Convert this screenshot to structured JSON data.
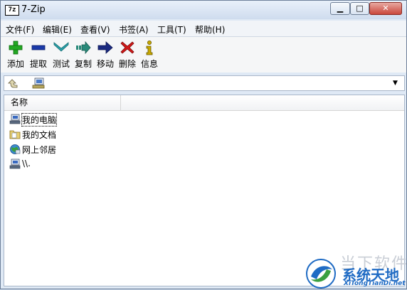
{
  "window": {
    "app_icon_text": "7z",
    "title": "7-Zip",
    "controls": {
      "minimize": "▁",
      "maximize": "□",
      "close": "✕"
    }
  },
  "menu": {
    "items": [
      {
        "label": "文件(F)"
      },
      {
        "label": "编辑(E)"
      },
      {
        "label": "查看(V)"
      },
      {
        "label": "书签(A)"
      },
      {
        "label": "工具(T)"
      },
      {
        "label": "帮助(H)"
      }
    ]
  },
  "toolbar": {
    "buttons": [
      {
        "label": "添加",
        "icon": "add-icon"
      },
      {
        "label": "提取",
        "icon": "extract-icon"
      },
      {
        "label": "测试",
        "icon": "test-icon"
      },
      {
        "label": "复制",
        "icon": "copy-icon"
      },
      {
        "label": "移动",
        "icon": "move-icon"
      },
      {
        "label": "删除",
        "icon": "delete-icon"
      },
      {
        "label": "信息",
        "icon": "info-icon"
      }
    ]
  },
  "address": {
    "value": "",
    "dropdown": "▼"
  },
  "list": {
    "columns": [
      {
        "label": "名称"
      }
    ],
    "rows": [
      {
        "name": "我的电脑",
        "icon": "computer-icon",
        "focused": true
      },
      {
        "name": "我的文档",
        "icon": "documents-folder-icon"
      },
      {
        "name": "网上邻居",
        "icon": "network-icon"
      },
      {
        "name": "\\\\.",
        "icon": "computer-icon"
      }
    ]
  },
  "watermark": {
    "faint_text": "当下软件园",
    "title": "系统天地",
    "subtitle": "XiTongTianDi.net"
  },
  "colors": {
    "add": "#22a822",
    "extract": "#1a3aa8",
    "test": "#2aa0a8",
    "copy": "#2a8a7a",
    "move": "#1a2a80",
    "delete": "#d01818",
    "info": "#c8a800",
    "watermark": "#1f6bc4"
  }
}
